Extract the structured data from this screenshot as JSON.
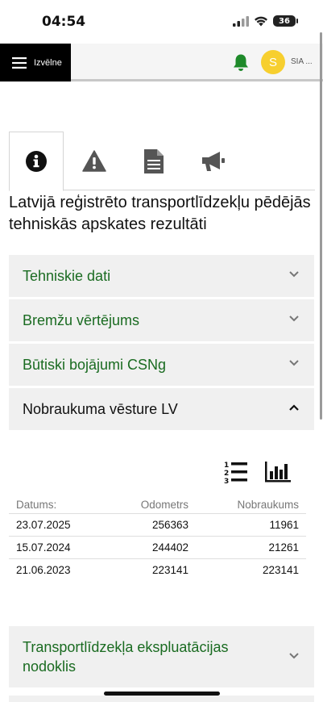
{
  "status": {
    "time": "04:54",
    "battery": "36"
  },
  "nav": {
    "menu_label": "Izvēlne",
    "avatar_letter": "S",
    "company": "SIA ..."
  },
  "icons": {
    "tab1": "info-circle-icon",
    "tab2": "warning-triangle-icon",
    "tab3": "document-icon",
    "tab4": "megaphone-icon",
    "bell": "bell-icon",
    "list_view": "numbered-list-icon",
    "chart_view": "bar-chart-icon"
  },
  "colors": {
    "accent_green": "#1a6b21",
    "bell_green": "#1e8a2a",
    "avatar_yellow": "#f7cf2f",
    "section_bg": "#f0f0f0"
  },
  "page": {
    "title": "Latvijā reģistrēto transportlīdzekļu pēdējās tehniskās apskates rezultāti"
  },
  "sections": [
    {
      "title": "Tehniskie dati"
    },
    {
      "title": "Bremžu vērtējums"
    },
    {
      "title": "Būtiski bojājumi CSNg"
    },
    {
      "title": "Nobraukuma vēsture LV"
    }
  ],
  "mileage_table": {
    "headers": [
      "Datums:",
      "Odometrs",
      "Nobraukums"
    ],
    "rows": [
      [
        "23.07.2025",
        "256363",
        "11961"
      ],
      [
        "15.07.2024",
        "244402",
        "21261"
      ],
      [
        "21.06.2023",
        "223141",
        "223141"
      ]
    ]
  },
  "tax_section": {
    "title": "Transportlīdzekļa ekspluatācijas nodoklis"
  }
}
